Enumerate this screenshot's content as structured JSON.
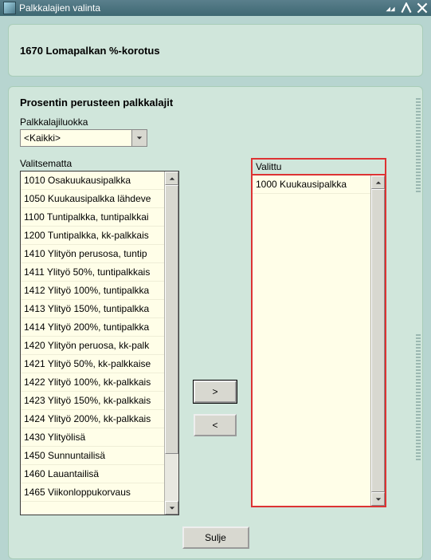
{
  "window": {
    "title": "Palkkalajien valinta"
  },
  "header": {
    "title": "1670 Lomapalkan %-korotus"
  },
  "section": {
    "title": "Prosentin perusteen palkkalajit",
    "category_label": "Palkkalajiluokka",
    "category_value": "<Kaikki>",
    "unselected_label": "Valitsematta",
    "selected_label": "Valittu"
  },
  "unselected_items": [
    "1010 Osakuukausipalkka",
    "1050 Kuukausipalkka lähdeve",
    "1100 Tuntipalkka, tuntipalkkai",
    "1200 Tuntipalkka, kk-palkkais",
    "1410 Ylityön perusosa, tuntip",
    "1411 Ylityö 50%, tuntipalkkais",
    "1412 Ylityö 100%, tuntipalkka",
    "1413 Ylityö 150%, tuntipalkka",
    "1414 Ylityö 200%, tuntipalkka",
    "1420 Ylityön peruosa, kk-palk",
    "1421 Ylityö 50%, kk-palkkaise",
    "1422 Ylityö 100%, kk-palkkais",
    "1423 Ylityö 150%, kk-palkkais",
    "1424 Ylityö 200%, kk-palkkais",
    "1430 Ylityölisä",
    "1450 Sunnuntailisä",
    "1460 Lauantailisä",
    "1465 Viikonloppukorvaus"
  ],
  "selected_items": [
    "1000 Kuukausipalkka"
  ],
  "buttons": {
    "move_right": ">",
    "move_left": "<",
    "close": "Sulje"
  }
}
